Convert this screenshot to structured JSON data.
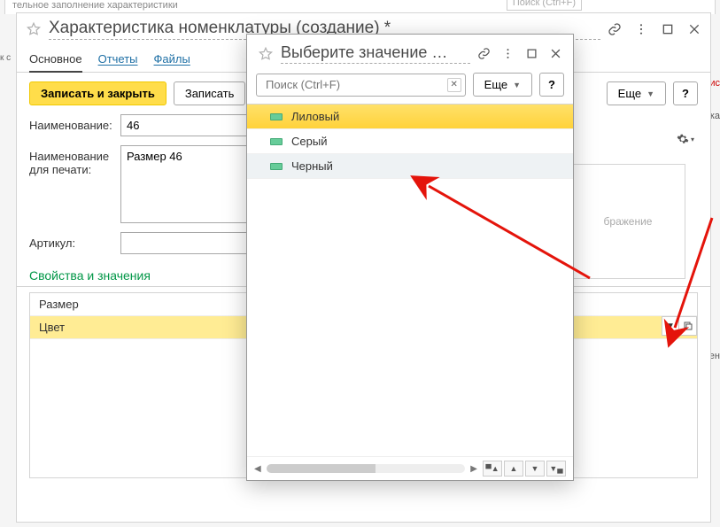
{
  "partial_top": {
    "text": "тельное заполнение характеристики",
    "search_placeholder": "Поиск (Ctrl+F)"
  },
  "window": {
    "title": "Характеристика номенклатуры (создание) *",
    "tabs": {
      "main": "Основное",
      "reports": "Отчеты",
      "files": "Файлы"
    },
    "toolbar": {
      "save_close": "Записать и закрыть",
      "save": "Записать",
      "more": "Еще",
      "help": "?"
    },
    "form": {
      "name_label": "Наименование:",
      "name_value": "46",
      "print_label": "Наименование для печати:",
      "print_value": "Размер 46",
      "sku_label": "Артикул:",
      "sku_value": "",
      "image_placeholder": "бражение"
    },
    "section": "Свойства и значения",
    "grid": {
      "rows": [
        "Размер",
        "Цвет"
      ]
    }
  },
  "dialog": {
    "title": "Выберите значение …",
    "search_placeholder": "Поиск (Ctrl+F)",
    "more": "Еще",
    "help": "?",
    "items": [
      "Лиловый",
      "Серый",
      "Черный"
    ]
  },
  "trunc": {
    "left": "к с",
    "r1": "ис",
    "r2": "ка",
    "r3": "ен"
  },
  "chart_data": null
}
